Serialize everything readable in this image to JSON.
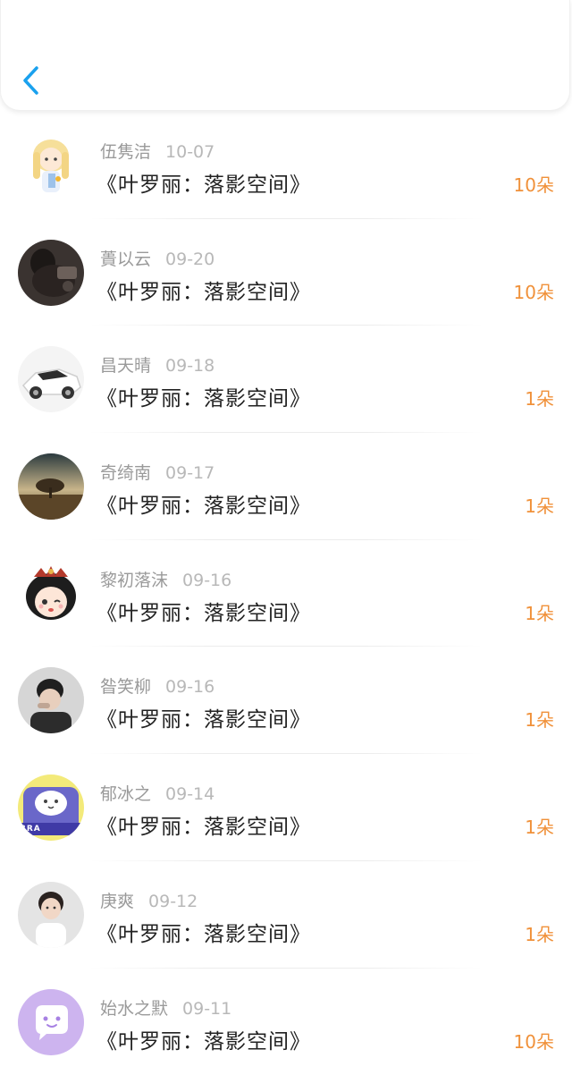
{
  "nav": {
    "back_icon": "chevron-left-icon",
    "accent": "#1aa1ee"
  },
  "colors": {
    "count": "#f0913a",
    "name": "#9a9a9a",
    "date": "#b8b8b8",
    "title": "#222222"
  },
  "items": [
    {
      "name": "伍隽洁",
      "date": "10-07",
      "title": "《叶罗丽：落影空间》",
      "count": "10朵",
      "avatar": "anime-blonde-girl-avatar"
    },
    {
      "name": "蕢以云",
      "date": "09-20",
      "title": "《叶罗丽：落影空间》",
      "count": "10朵",
      "avatar": "dark-photo-avatar"
    },
    {
      "name": "昌天晴",
      "date": "09-18",
      "title": "《叶罗丽：落影空间》",
      "count": "1朵",
      "avatar": "white-car-avatar"
    },
    {
      "name": "奇绮南",
      "date": "09-17",
      "title": "《叶罗丽：落影空间》",
      "count": "1朵",
      "avatar": "sunset-tree-avatar"
    },
    {
      "name": "黎初落沫",
      "date": "09-16",
      "title": "《叶罗丽：落影空间》",
      "count": "1朵",
      "avatar": "anime-crown-girl-avatar"
    },
    {
      "name": "昝笑柳",
      "date": "09-16",
      "title": "《叶罗丽：落影空间》",
      "count": "1朵",
      "avatar": "boy-photo-avatar"
    },
    {
      "name": "郁冰之",
      "date": "09-14",
      "title": "《叶罗丽：落影空间》",
      "count": "1朵",
      "avatar": "cartoon-cat-avatar",
      "avatar_text": "BRA"
    },
    {
      "name": "庚爽",
      "date": "09-12",
      "title": "《叶罗丽：落影空间》",
      "count": "1朵",
      "avatar": "girl-photo-avatar"
    },
    {
      "name": "始水之默",
      "date": "09-11",
      "title": "《叶罗丽：落影空间》",
      "count": "10朵",
      "avatar": "purple-chat-bubble-avatar"
    }
  ]
}
